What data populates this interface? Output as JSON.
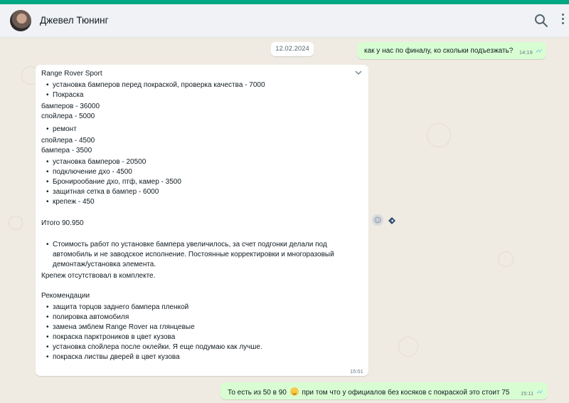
{
  "header": {
    "contact_name": "Джевел Тюнинг",
    "icons": {
      "search": "search-icon",
      "menu": "kebab-menu-icon"
    }
  },
  "chat": {
    "date_separator": "12.02.2024",
    "outgoing_1": {
      "text": "как у нас по финалу, ко скольки подъезжать?",
      "time": "14:19",
      "status": "read"
    },
    "incoming": {
      "title": "Range Rover Sport",
      "bullets_a": [
        "установка бамперов перед покраской, проверка качества - 7000",
        "Покраска"
      ],
      "lines_a": [
        "бамперов - 36000",
        "спойлера - 5000"
      ],
      "bullets_b": [
        "ремонт"
      ],
      "lines_b": [
        "спойлера - 4500",
        "бампера - 3500"
      ],
      "bullets_c": [
        "установка бамперов - 20500",
        "подключение дхо - 4500",
        "Бронирообание дхо, птф, камер - 3500",
        "защитная сетка в бампер - 6000",
        "крепеж - 450"
      ],
      "total": "Итого 90.950",
      "note_bullet": [
        "Стоимость работ по установке бампера увеличилось, за счет подгонки делали под",
        "автомобиль и не заводское исполнение. Постоянные корректировки и многоразовый",
        "демонтаж/установка элемента."
      ],
      "fastener_note": "Крепеж отсутствовал в комплекте.",
      "recommendations_title": "Рекомендации",
      "recommendations": [
        "защита торцов заднего бампера пленкой",
        "полировка автомобиля",
        "замена эмблем Range Rover на глянцевые",
        "покраска парктроников в цвет кузова",
        "установка спойлера после оклейки. Я еще подумаю как лучше.",
        "покраска листвы дверей в цвет кузова"
      ],
      "time": "15:01"
    },
    "outgoing_2": {
      "text_before": "То есть из 50 в 90",
      "emoji": "grinning-sweat-emoji",
      "text_after": "при том что у официалов  без косяков с покраской это стоит 75",
      "time": "15:11",
      "status": "read"
    }
  },
  "colors": {
    "accent": "#00a884",
    "outgoing_bubble": "#d9fdd3",
    "incoming_bubble": "#ffffff",
    "chat_background": "#efeae2",
    "read_ticks": "#53bdeb"
  }
}
